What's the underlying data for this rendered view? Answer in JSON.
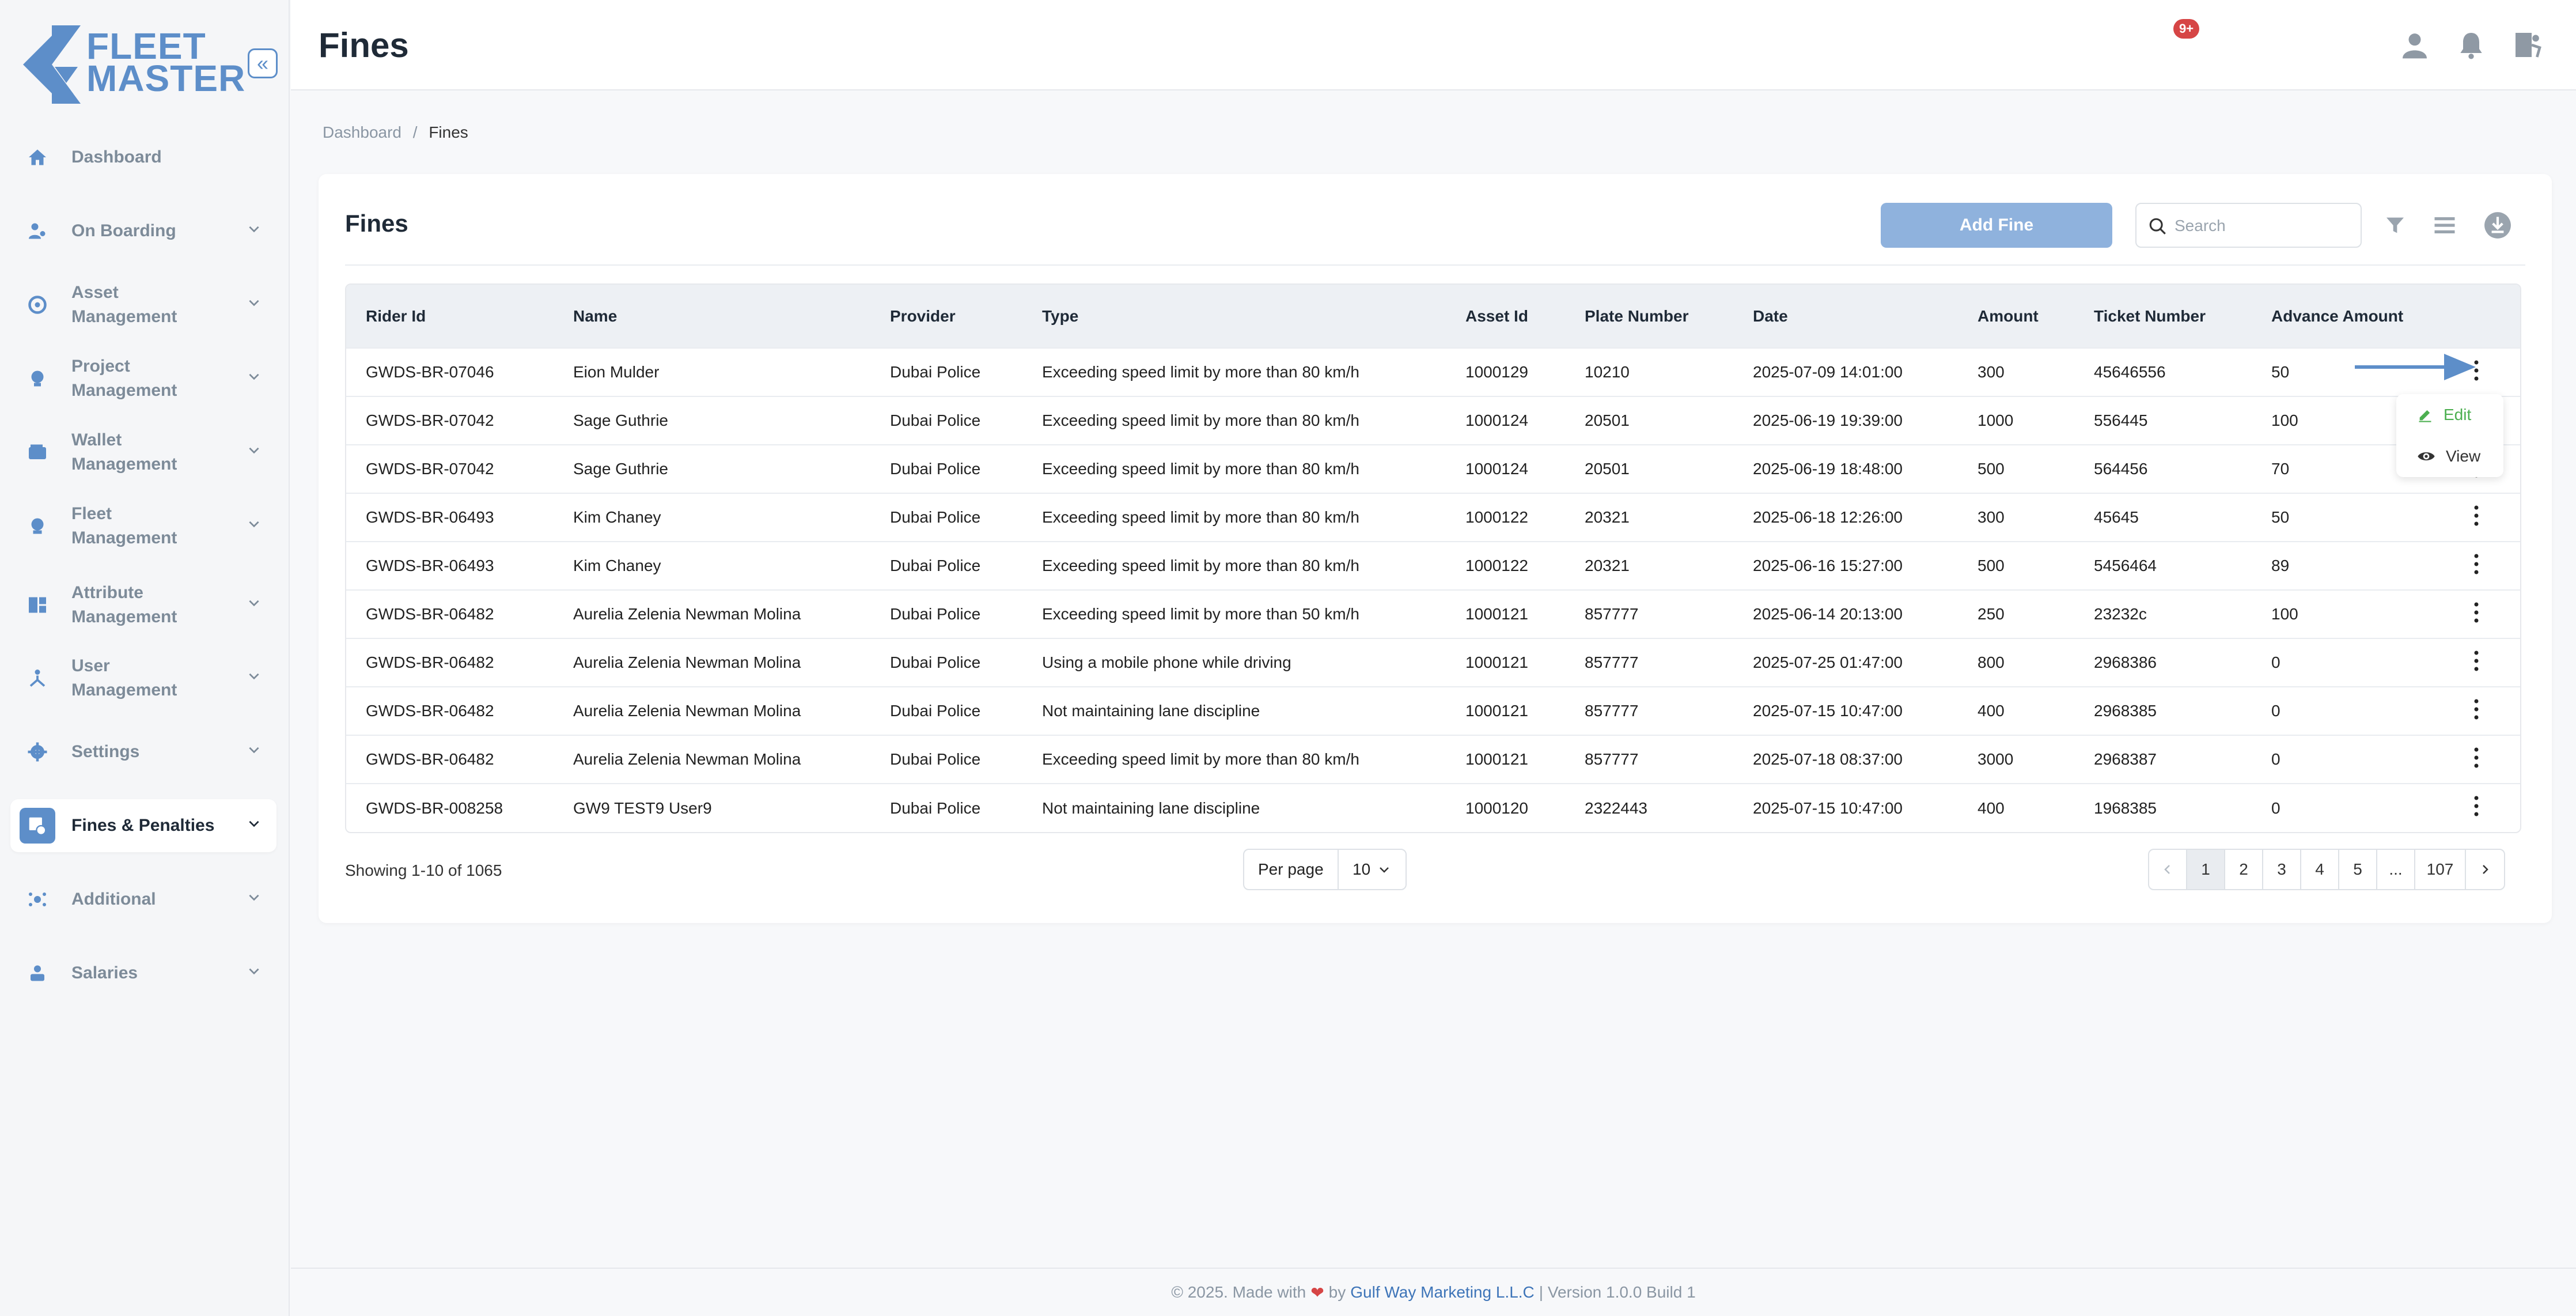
{
  "app": {
    "logo_line1": "FLEET",
    "logo_line2": "MASTER",
    "brand_color": "#5d8ec9"
  },
  "sidebar": {
    "items": [
      {
        "label": "Dashboard",
        "icon": "home-icon"
      },
      {
        "label": "On Boarding",
        "icon": "onboarding-icon"
      },
      {
        "label": "Asset Management",
        "icon": "asset-icon"
      },
      {
        "label": "Project Management",
        "icon": "project-icon"
      },
      {
        "label": "Wallet Management",
        "icon": "wallet-icon"
      },
      {
        "label": "Fleet Management",
        "icon": "fleet-icon"
      },
      {
        "label": "Attribute Management",
        "icon": "attribute-icon"
      },
      {
        "label": "User Management",
        "icon": "users-icon"
      },
      {
        "label": "Settings",
        "icon": "gear-icon"
      },
      {
        "label": "Fines & Penalties",
        "icon": "fines-icon"
      },
      {
        "label": "Additional",
        "icon": "additional-icon"
      },
      {
        "label": "Salaries",
        "icon": "salaries-icon"
      }
    ]
  },
  "header": {
    "title": "Fines",
    "notification_badge": "9+"
  },
  "breadcrumb": {
    "root": "Dashboard",
    "separator": "/",
    "current": "Fines"
  },
  "card": {
    "title": "Fines",
    "add_label": "Add Fine",
    "search_placeholder": "Search"
  },
  "table": {
    "columns": [
      "Rider Id",
      "Name",
      "Provider",
      "Type",
      "Asset Id",
      "Plate Number",
      "Date",
      "Amount",
      "Ticket Number",
      "Advance Amount"
    ],
    "rows": [
      [
        "GWDS-BR-07046",
        "Eion Mulder",
        "Dubai Police",
        "Exceeding speed limit by more than 80 km/h",
        "1000129",
        "10210",
        "2025-07-09 14:01:00",
        "300",
        "45646556",
        "50"
      ],
      [
        "GWDS-BR-07042",
        "Sage Guthrie",
        "Dubai Police",
        "Exceeding speed limit by more than 80 km/h",
        "1000124",
        "20501",
        "2025-06-19 19:39:00",
        "1000",
        "556445",
        "100"
      ],
      [
        "GWDS-BR-07042",
        "Sage Guthrie",
        "Dubai Police",
        "Exceeding speed limit by more than 80 km/h",
        "1000124",
        "20501",
        "2025-06-19 18:48:00",
        "500",
        "564456",
        "70"
      ],
      [
        "GWDS-BR-06493",
        "Kim Chaney",
        "Dubai Police",
        "Exceeding speed limit by more than 80 km/h",
        "1000122",
        "20321",
        "2025-06-18 12:26:00",
        "300",
        "45645",
        "50"
      ],
      [
        "GWDS-BR-06493",
        "Kim Chaney",
        "Dubai Police",
        "Exceeding speed limit by more than 80 km/h",
        "1000122",
        "20321",
        "2025-06-16 15:27:00",
        "500",
        "5456464",
        "89"
      ],
      [
        "GWDS-BR-06482",
        "Aurelia Zelenia Newman Molina",
        "Dubai Police",
        "Exceeding speed limit by more than 50 km/h",
        "1000121",
        "857777",
        "2025-06-14 20:13:00",
        "250",
        "23232c",
        "100"
      ],
      [
        "GWDS-BR-06482",
        "Aurelia Zelenia Newman Molina",
        "Dubai Police",
        "Using a mobile phone while driving",
        "1000121",
        "857777",
        "2025-07-25 01:47:00",
        "800",
        "2968386",
        "0"
      ],
      [
        "GWDS-BR-06482",
        "Aurelia Zelenia Newman Molina",
        "Dubai Police",
        "Not maintaining lane discipline",
        "1000121",
        "857777",
        "2025-07-15 10:47:00",
        "400",
        "2968385",
        "0"
      ],
      [
        "GWDS-BR-06482",
        "Aurelia Zelenia Newman Molina",
        "Dubai Police",
        "Exceeding speed limit by more than 80 km/h",
        "1000121",
        "857777",
        "2025-07-18 08:37:00",
        "3000",
        "2968387",
        "0"
      ],
      [
        "GWDS-BR-008258",
        "GW9 TEST9 User9",
        "Dubai Police",
        "Not maintaining lane discipline",
        "1000120",
        "2322443",
        "2025-07-15 10:47:00",
        "400",
        "1968385",
        "0"
      ]
    ]
  },
  "row_menu": {
    "edit_label": "Edit",
    "view_label": "View"
  },
  "pagination": {
    "showing": "Showing 1-10 of 1065",
    "per_page_label": "Per page",
    "per_page_value": "10",
    "pages": [
      "1",
      "2",
      "3",
      "4",
      "5",
      "...",
      "107"
    ],
    "current_page": "1"
  },
  "footer": {
    "prefix": "© 2025. Made with",
    "by": "by",
    "company": "Gulf Way Marketing L.L.C",
    "suffix": "| Version 1.0.0 Build 1"
  }
}
